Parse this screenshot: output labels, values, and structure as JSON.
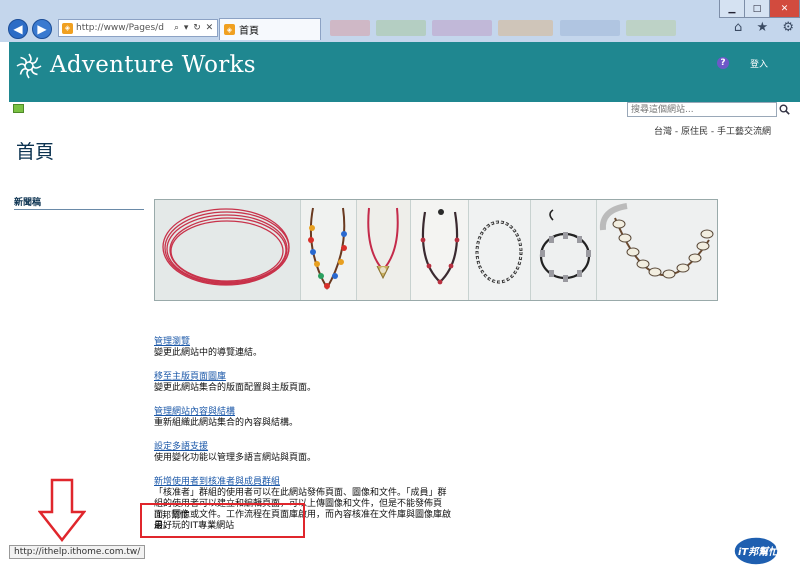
{
  "browser": {
    "address_url": "http://www/Pages/d",
    "address_actions": "⌕ ▾ ↻ ✕",
    "tab_title": "首頁",
    "status_url": "http://ithelp.ithome.com.tw/"
  },
  "site": {
    "title": "Adventure Works",
    "help": "?",
    "signin": "登入",
    "search_placeholder": "搜尋這個網站...",
    "breadcrumb": "台灣 - 原住民 - 手工藝交流網"
  },
  "page": {
    "title": "首頁",
    "quick_launch_heading": "新聞稿"
  },
  "links": [
    {
      "title": "管理瀏覽",
      "desc": "變更此網站中的導覽連結。"
    },
    {
      "title": "移至主版頁面圖庫",
      "desc": "變更此網站集合的版面配置與主版頁面。"
    },
    {
      "title": "管理網站內容與結構",
      "desc": "重新組織此網站集合的內容與結構。"
    },
    {
      "title": "設定多語支援",
      "desc": "使用變化功能以管理多語言網站與頁面。"
    },
    {
      "title": "新增使用者到核准者與成員群組",
      "desc": "「核准者」群組的使用者可以在此網站發佈頁面、圖像和文件。「成員」群組的使用者可以建立和編輯頁面，可以上傳圖像和文件，但是不能發佈頁面、圖像或文件。工作流程在頁面庫啟用，而內容核准在文件庫與圖像庫啟用。"
    }
  ],
  "notes": {
    "line1": "iT邦幫忙",
    "line2": "最好玩的IT專業網站"
  },
  "watermark": "iT邦幫忙",
  "colors": {
    "header_bg": "#1f8790",
    "link": "#1a57a8",
    "annotation": "#e0262c"
  }
}
